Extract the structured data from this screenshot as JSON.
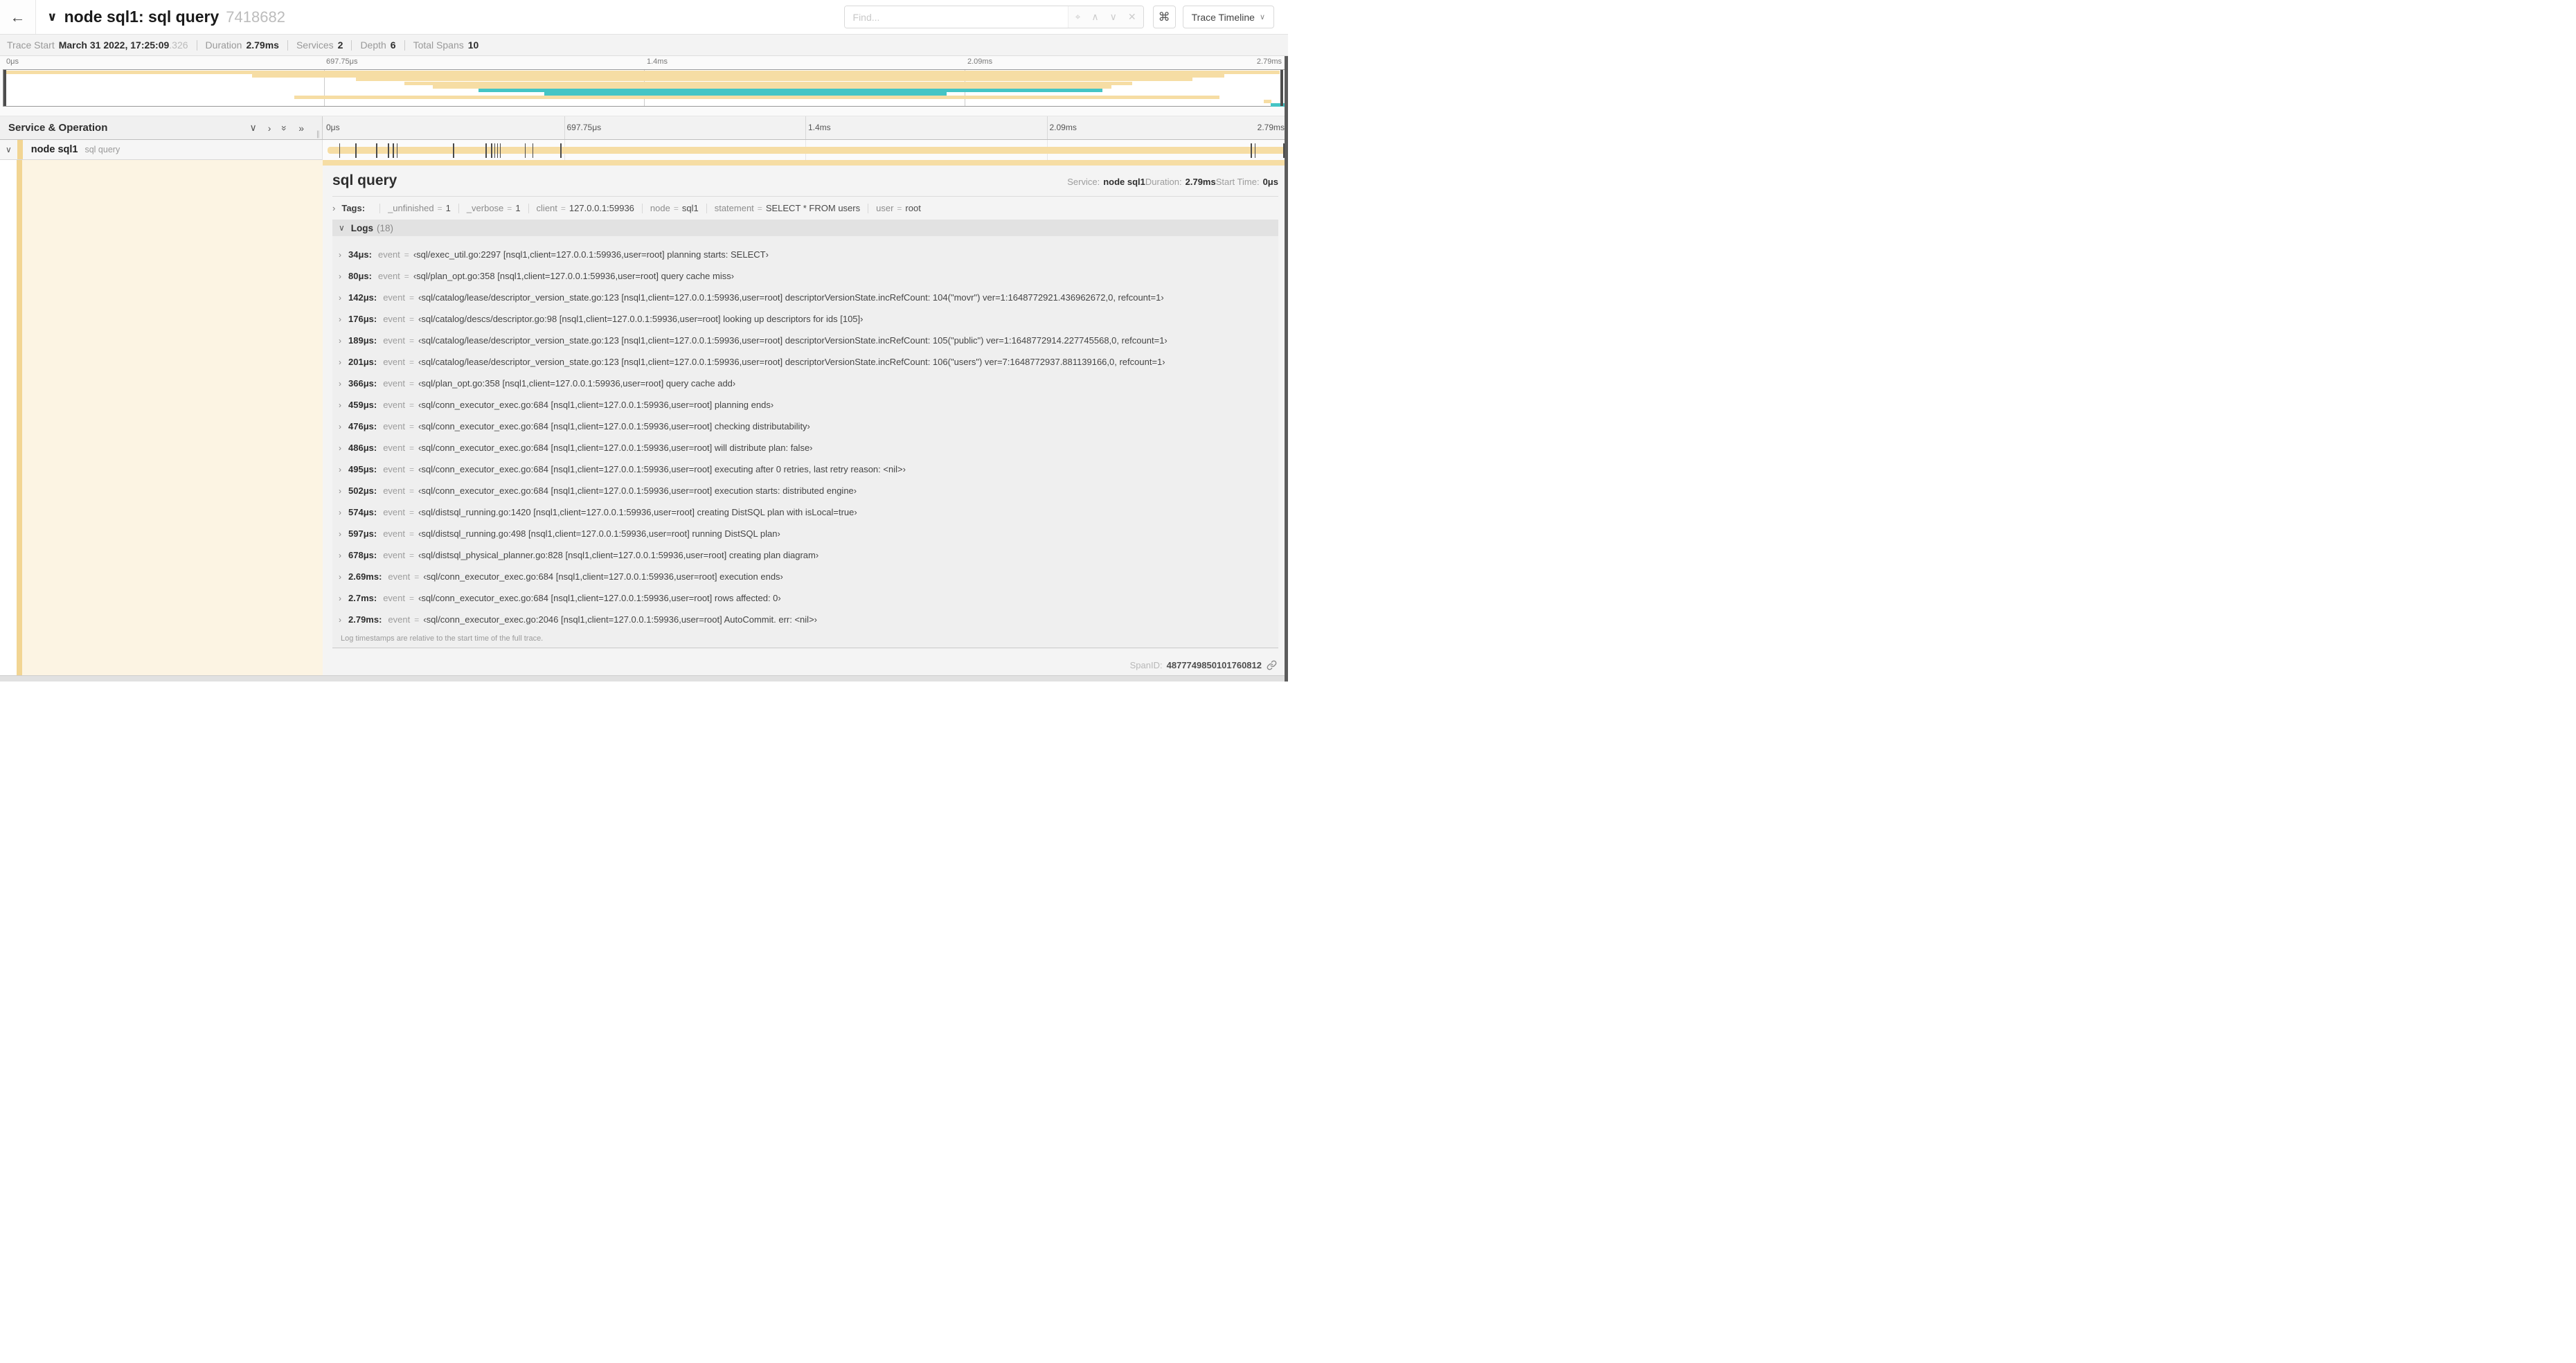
{
  "colors": {
    "tan": "#f6dda4",
    "tan_deep": "#f2d593",
    "teal": "#45c5c5",
    "cream": "#fcf4e3"
  },
  "header": {
    "back_icon": "arrow-left",
    "collapse_icon": "chevron-down",
    "title": "node sql1: sql query",
    "trace_id": "7418682",
    "find_placeholder": "Find...",
    "find_icons": [
      "locate-icon",
      "chevron-up-icon",
      "chevron-down-icon",
      "close-icon"
    ],
    "keyboard_shortcuts_icon": "command-key",
    "view_button_label": "Trace Timeline"
  },
  "summary": {
    "items": [
      {
        "label": "Trace Start",
        "value": "March 31 2022, 17:25:09",
        "suffix": ".326"
      },
      {
        "label": "Duration",
        "value": "2.79ms",
        "suffix": ""
      },
      {
        "label": "Services",
        "value": "2",
        "suffix": ""
      },
      {
        "label": "Depth",
        "value": "6",
        "suffix": ""
      },
      {
        "label": "Total Spans",
        "value": "10",
        "suffix": ""
      }
    ]
  },
  "timeline": {
    "ticks": [
      "0μs",
      "697.75μs",
      "1.4ms",
      "2.09ms",
      "2.79ms"
    ],
    "minimap_spans": [
      {
        "start": 0,
        "end": 99.6,
        "color": "tan"
      },
      {
        "start": 19.4,
        "end": 95.3,
        "color": "tan"
      },
      {
        "start": 27.5,
        "end": 92.8,
        "color": "tan"
      },
      {
        "start": 31.3,
        "end": 88.1,
        "color": "tan"
      },
      {
        "start": 33.5,
        "end": 86.5,
        "color": "tan"
      },
      {
        "start": 37.1,
        "end": 85.8,
        "color": "teal"
      },
      {
        "start": 42.2,
        "end": 73.6,
        "color": "teal"
      },
      {
        "start": 22.7,
        "end": 94.9,
        "color": "tan"
      },
      {
        "start": 98.4,
        "end": 99.0,
        "color": "tan"
      },
      {
        "start": 98.9,
        "end": 100,
        "color": "teal"
      }
    ],
    "header_label": "Service & Operation",
    "log_marker_pcts": [
      1.2,
      2.9,
      5.1,
      6.3,
      6.8,
      7.2,
      13.1,
      16.5,
      17.1,
      17.4,
      17.7,
      18.0,
      20.6,
      21.4,
      24.3,
      96.4,
      96.8,
      99.8
    ]
  },
  "row": {
    "service": "node sql1",
    "operation": "sql query"
  },
  "detail": {
    "title": "sql query",
    "meta": [
      {
        "label": "Service:",
        "value": "node sql1"
      },
      {
        "label": "Duration:",
        "value": "2.79ms"
      },
      {
        "label": "Start Time:",
        "value": "0μs"
      }
    ],
    "tags_label": "Tags:",
    "tags": [
      {
        "k": "_unfinished",
        "v": "1"
      },
      {
        "k": "_verbose",
        "v": "1"
      },
      {
        "k": "client",
        "v": "127.0.0.1:59936"
      },
      {
        "k": "node",
        "v": "sql1"
      },
      {
        "k": "statement",
        "v": "SELECT * FROM users"
      },
      {
        "k": "user",
        "v": "root"
      }
    ],
    "logs_label": "Logs",
    "logs_count": "(18)",
    "logs": [
      {
        "t": "34μs:",
        "k": "event",
        "v": "‹sql/exec_util.go:2297 [nsql1,client=127.0.0.1:59936,user=root] planning starts: SELECT›"
      },
      {
        "t": "80μs:",
        "k": "event",
        "v": "‹sql/plan_opt.go:358 [nsql1,client=127.0.0.1:59936,user=root] query cache miss›"
      },
      {
        "t": "142μs:",
        "k": "event",
        "v": "‹sql/catalog/lease/descriptor_version_state.go:123 [nsql1,client=127.0.0.1:59936,user=root] descriptorVersionState.incRefCount: 104(\"movr\") ver=1:1648772921.436962672,0, refcount=1›"
      },
      {
        "t": "176μs:",
        "k": "event",
        "v": "‹sql/catalog/descs/descriptor.go:98 [nsql1,client=127.0.0.1:59936,user=root] looking up descriptors for ids [105]›"
      },
      {
        "t": "189μs:",
        "k": "event",
        "v": "‹sql/catalog/lease/descriptor_version_state.go:123 [nsql1,client=127.0.0.1:59936,user=root] descriptorVersionState.incRefCount: 105(\"public\") ver=1:1648772914.227745568,0, refcount=1›"
      },
      {
        "t": "201μs:",
        "k": "event",
        "v": "‹sql/catalog/lease/descriptor_version_state.go:123 [nsql1,client=127.0.0.1:59936,user=root] descriptorVersionState.incRefCount: 106(\"users\") ver=7:1648772937.881139166,0, refcount=1›"
      },
      {
        "t": "366μs:",
        "k": "event",
        "v": "‹sql/plan_opt.go:358 [nsql1,client=127.0.0.1:59936,user=root] query cache add›"
      },
      {
        "t": "459μs:",
        "k": "event",
        "v": "‹sql/conn_executor_exec.go:684 [nsql1,client=127.0.0.1:59936,user=root] planning ends›"
      },
      {
        "t": "476μs:",
        "k": "event",
        "v": "‹sql/conn_executor_exec.go:684 [nsql1,client=127.0.0.1:59936,user=root] checking distributability›"
      },
      {
        "t": "486μs:",
        "k": "event",
        "v": "‹sql/conn_executor_exec.go:684 [nsql1,client=127.0.0.1:59936,user=root] will distribute plan: false›"
      },
      {
        "t": "495μs:",
        "k": "event",
        "v": "‹sql/conn_executor_exec.go:684 [nsql1,client=127.0.0.1:59936,user=root] executing after 0 retries, last retry reason: <nil>›"
      },
      {
        "t": "502μs:",
        "k": "event",
        "v": "‹sql/conn_executor_exec.go:684 [nsql1,client=127.0.0.1:59936,user=root] execution starts: distributed engine›"
      },
      {
        "t": "574μs:",
        "k": "event",
        "v": "‹sql/distsql_running.go:1420 [nsql1,client=127.0.0.1:59936,user=root] creating DistSQL plan with isLocal=true›"
      },
      {
        "t": "597μs:",
        "k": "event",
        "v": "‹sql/distsql_running.go:498 [nsql1,client=127.0.0.1:59936,user=root] running DistSQL plan›"
      },
      {
        "t": "678μs:",
        "k": "event",
        "v": "‹sql/distsql_physical_planner.go:828 [nsql1,client=127.0.0.1:59936,user=root] creating plan diagram›"
      },
      {
        "t": "2.69ms:",
        "k": "event",
        "v": "‹sql/conn_executor_exec.go:684 [nsql1,client=127.0.0.1:59936,user=root] execution ends›"
      },
      {
        "t": "2.7ms:",
        "k": "event",
        "v": "‹sql/conn_executor_exec.go:684 [nsql1,client=127.0.0.1:59936,user=root] rows affected: 0›"
      },
      {
        "t": "2.79ms:",
        "k": "event",
        "v": "‹sql/conn_executor_exec.go:2046 [nsql1,client=127.0.0.1:59936,user=root] AutoCommit. err: <nil>›"
      }
    ],
    "logs_footnote": "Log timestamps are relative to the start time of the full trace.",
    "span_id_label": "SpanID:",
    "span_id": "4877749850101760812"
  }
}
